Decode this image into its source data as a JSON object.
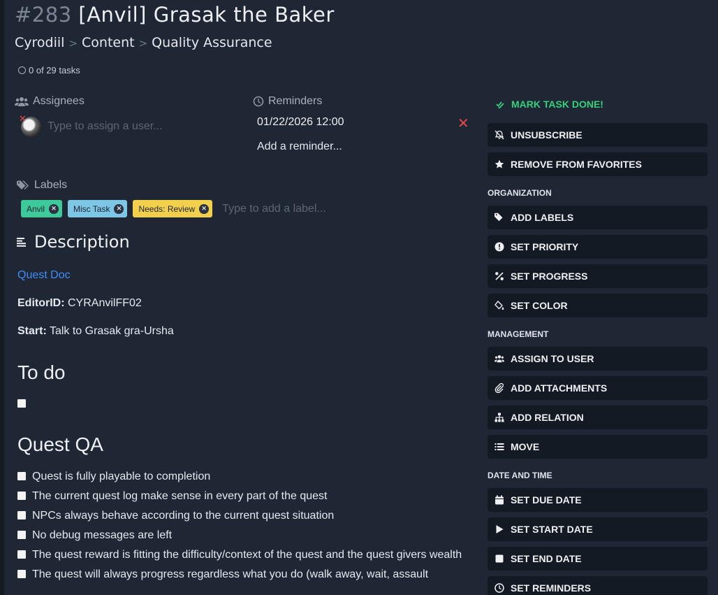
{
  "task": {
    "number": "#283",
    "title": "[Anvil] Grasak the Baker"
  },
  "breadcrumb": [
    "Cyrodiil",
    "Content",
    "Quality Assurance"
  ],
  "progress": {
    "text": "0 of 29 tasks"
  },
  "assignees": {
    "heading": "Assignees",
    "placeholder": "Type to assign a user..."
  },
  "reminders": {
    "heading": "Reminders",
    "date": "01/22/2026 12:00",
    "add_label": "Add a reminder..."
  },
  "labels": {
    "heading": "Labels",
    "items": [
      {
        "name": "Anvil",
        "color": "#3ec99a"
      },
      {
        "name": "Misc Task",
        "color": "#7ec6e6"
      },
      {
        "name": "Needs: Review",
        "color": "#f2d04b"
      }
    ],
    "placeholder": "Type to add a label..."
  },
  "description": {
    "heading": "Description",
    "link": "Quest Doc",
    "editor_label": "EditorID:",
    "editor_value": "CYRAnvilFF02",
    "start_label": "Start:",
    "start_value": "Talk to Grasak gra-Ursha",
    "todo_heading": "To do",
    "qa_heading": "Quest QA",
    "qa_items": [
      "Quest is fully playable to completion",
      "The current quest log make sense in every part of the quest",
      "NPCs always behave according to the current quest situation",
      "No debug messages are left",
      "The quest reward is fitting the difficulty/context of the quest and the quest givers wealth",
      "The quest will always progress regardless what you do (walk away, wait, assault"
    ]
  },
  "sidebar": {
    "mark_done": "MARK TASK DONE!",
    "unsubscribe": "UNSUBSCRIBE",
    "favorites": "REMOVE FROM FAVORITES",
    "organization": "ORGANIZATION",
    "add_labels": "ADD LABELS",
    "set_priority": "SET PRIORITY",
    "set_progress": "SET PROGRESS",
    "set_color": "SET COLOR",
    "management": "MANAGEMENT",
    "assign_user": "ASSIGN TO USER",
    "add_attachments": "ADD ATTACHMENTS",
    "add_relation": "ADD RELATION",
    "move": "MOVE",
    "date_time": "DATE AND TIME",
    "due_date": "SET DUE DATE",
    "start_date": "SET START DATE",
    "end_date": "SET END DATE",
    "set_reminders": "SET REMINDERS"
  }
}
